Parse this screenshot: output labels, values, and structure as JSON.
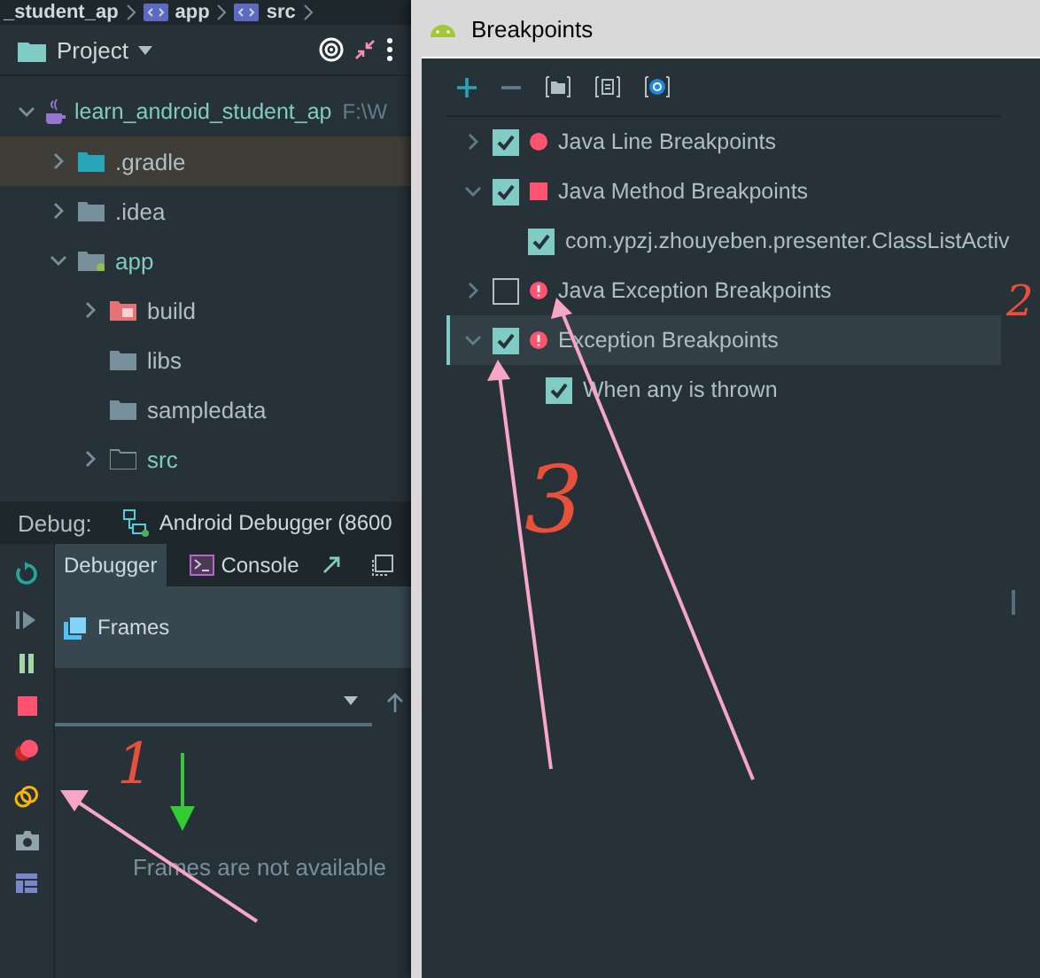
{
  "breadcrumb": [
    "_student_ap",
    "app",
    "src"
  ],
  "project_panel": {
    "title": "Project",
    "tree": [
      {
        "label": "learn_android_student_ap",
        "path": "F:\\W",
        "kind": "module",
        "expanded": true,
        "selected": false,
        "children": [
          {
            "label": ".gradle",
            "kind": "folder-special",
            "expanded": false,
            "selected": true
          },
          {
            "label": ".idea",
            "kind": "folder",
            "expanded": false,
            "selected": false
          },
          {
            "label": "app",
            "kind": "module-folder",
            "expanded": true,
            "selected": false,
            "children": [
              {
                "label": "build",
                "kind": "excluded-folder",
                "expanded": false,
                "selected": false
              },
              {
                "label": "libs",
                "kind": "folder",
                "selected": false
              },
              {
                "label": "sampledata",
                "kind": "folder",
                "selected": false
              },
              {
                "label": "src",
                "kind": "source-folder",
                "expanded": false,
                "selected": false
              }
            ]
          }
        ]
      }
    ]
  },
  "debug": {
    "label": "Debug:",
    "session": "Android Debugger (8600",
    "tabs": [
      {
        "label": "Debugger",
        "selected": true
      },
      {
        "label": "Console",
        "selected": false
      }
    ],
    "frames_title": "Frames",
    "empty_text": "Frames are not available"
  },
  "dialog": {
    "title": "Breakpoints",
    "tree": [
      {
        "label": "Java Line Breakpoints",
        "kind": "line",
        "checked": true,
        "expanded": false,
        "selected": false
      },
      {
        "label": "Java Method Breakpoints",
        "kind": "method",
        "checked": true,
        "expanded": true,
        "selected": false,
        "children": [
          {
            "label": "com.ypzj.zhouyeben.presenter.ClassListActiv",
            "checked": true,
            "selected": false
          }
        ]
      },
      {
        "label": "Java Exception Breakpoints",
        "kind": "exception",
        "checked": false,
        "expanded": false,
        "selected": false
      },
      {
        "label": "Exception Breakpoints",
        "kind": "exception",
        "checked": true,
        "expanded": true,
        "selected": true,
        "children": [
          {
            "label": "When any is thrown",
            "checked": true,
            "selected": false
          }
        ]
      }
    ]
  },
  "annotations": [
    {
      "kind": "number",
      "text": "1",
      "color": "#e8503a"
    },
    {
      "kind": "number",
      "text": "2",
      "color": "#e8503a"
    },
    {
      "kind": "number",
      "text": "3",
      "color": "#e8503a"
    }
  ]
}
